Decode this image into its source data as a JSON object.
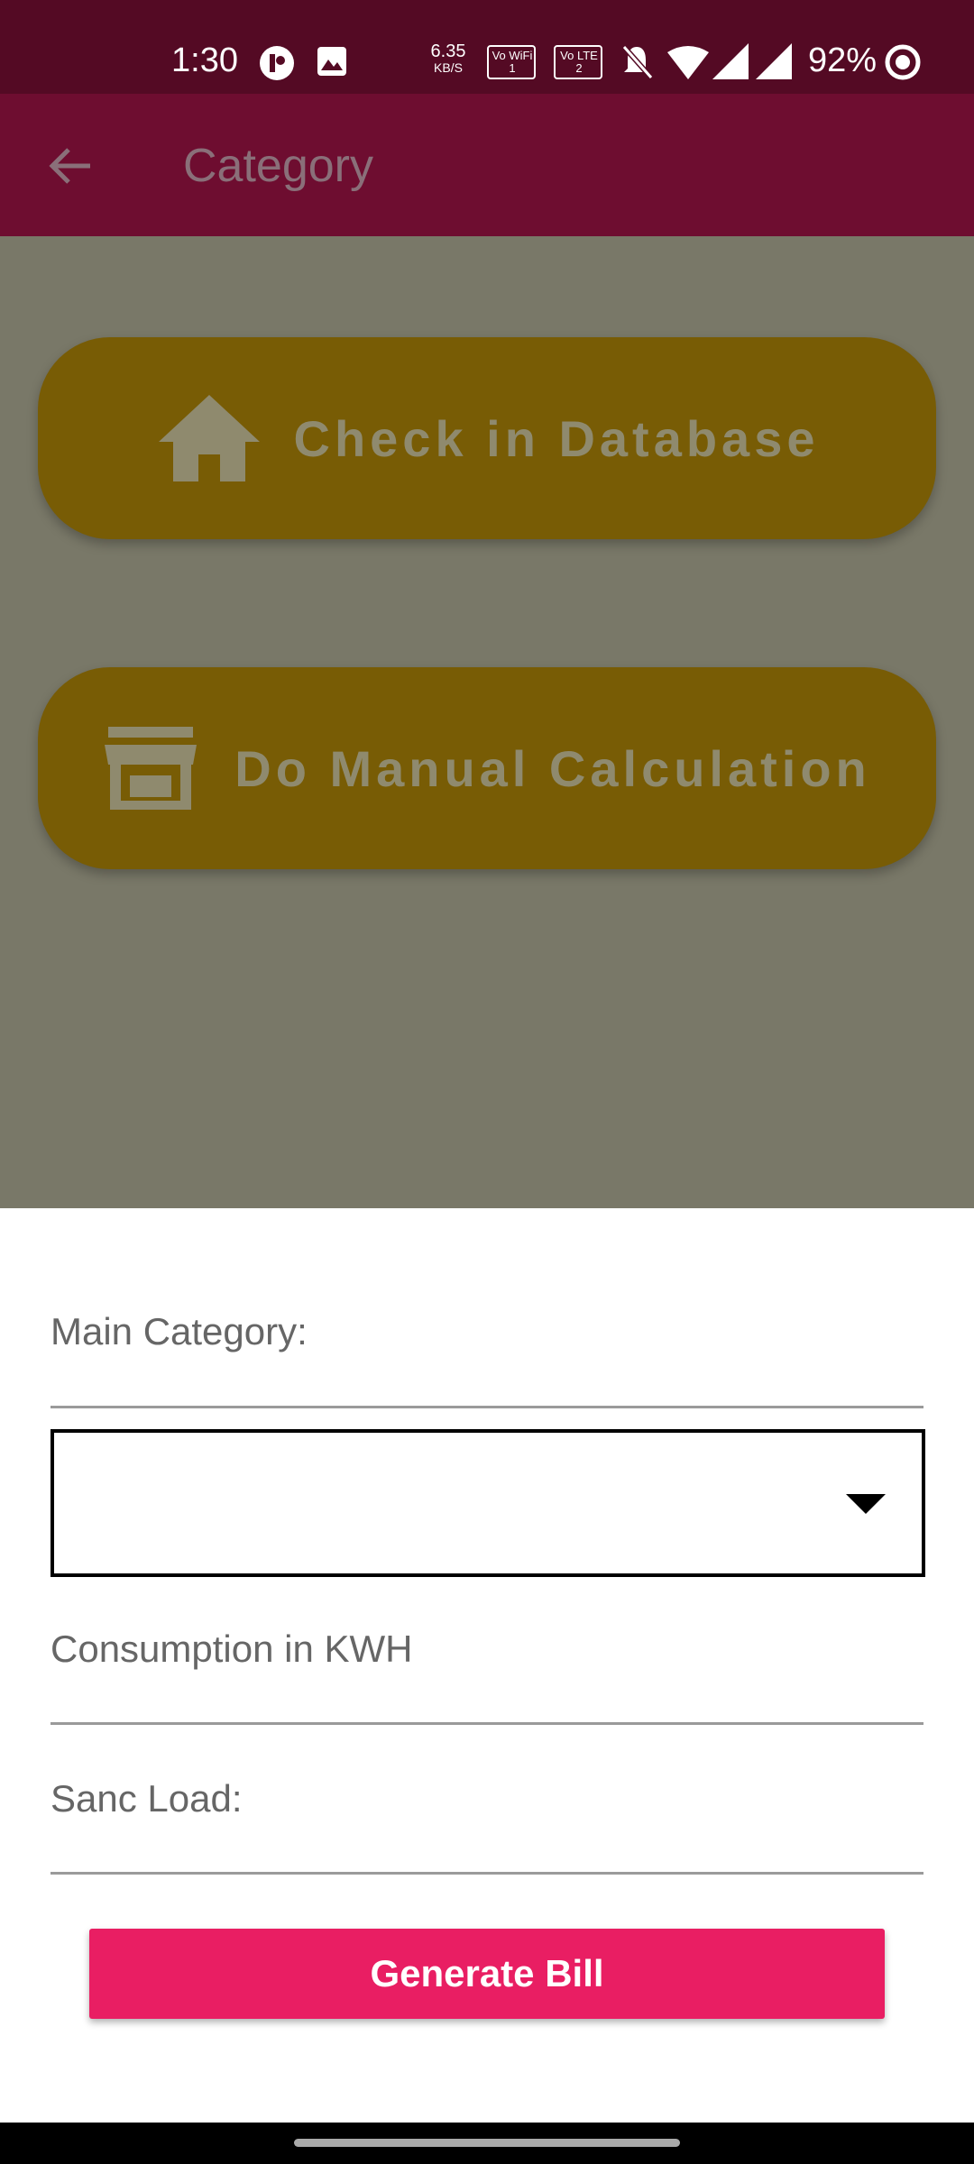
{
  "status_bar": {
    "time": "1:30",
    "net_speed_value": "6.35",
    "net_speed_unit": "KB/S",
    "volte1_label": "Vo WiFi 1",
    "volte2_label": "Vo LTE 2",
    "battery": "92%"
  },
  "app_bar": {
    "title": "Category",
    "back_icon": "arrow-left-icon"
  },
  "main": {
    "check_database_label": "Check in Database",
    "manual_calculation_label": "Do Manual Calculation",
    "check_database_icon": "home-icon",
    "manual_calculation_icon": "store-icon"
  },
  "sheet": {
    "main_category_label": "Main Category:",
    "dropdown_selected": "",
    "consumption_label": "Consumption in KWH",
    "sanc_load_label": "Sanc Load:",
    "generate_bill_label": "Generate Bill"
  },
  "colors": {
    "status_bar": "#540a24",
    "app_bar": "#6e0d30",
    "scrim": "#797868",
    "scrim_button": "#785c05",
    "accent_button": "#e91e63"
  }
}
